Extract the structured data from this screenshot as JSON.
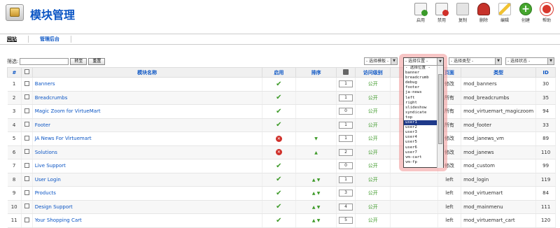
{
  "header": {
    "title": "模块管理"
  },
  "toolbar": [
    {
      "label": "启用",
      "icon": "publish-icon"
    },
    {
      "label": "禁用",
      "icon": "unpublish-icon"
    },
    {
      "label": "复制",
      "icon": "copy-icon"
    },
    {
      "label": "删除",
      "icon": "delete-icon"
    },
    {
      "label": "编辑",
      "icon": "edit-icon"
    },
    {
      "label": "创建",
      "icon": "new-icon"
    },
    {
      "label": "帮助",
      "icon": "help-icon"
    }
  ],
  "subnav": {
    "site": "网站",
    "admin": "管理后台"
  },
  "filter": {
    "label": "筛选:",
    "go": "转至",
    "reset": "重置",
    "template_select": "- 选择模板 -",
    "position_select": "- 选择位置 -",
    "type_select": "- 选择类型 -",
    "state_select": "- 选择状态 -"
  },
  "columns": [
    "#",
    "模块名称",
    "启用",
    "排序",
    "访问级别",
    "页面",
    "类型",
    "ID"
  ],
  "rows": [
    {
      "num": "1",
      "name": "Banners",
      "enabled": true,
      "order": "1",
      "access": "公开",
      "pages": "修改",
      "type": "mod_banners",
      "id": "30"
    },
    {
      "num": "2",
      "name": "Breadcrumbs",
      "enabled": true,
      "order": "1",
      "access": "公开",
      "pages": "所有",
      "type": "mod_breadcrumbs",
      "id": "35"
    },
    {
      "num": "3",
      "name": "Magic Zoom for VirtueMart",
      "enabled": true,
      "order": "0",
      "access": "公开",
      "pages": "所有",
      "type": "mod_virtuemart_magiczoom",
      "id": "94"
    },
    {
      "num": "4",
      "name": "Footer",
      "enabled": true,
      "order": "1",
      "access": "公开",
      "pages": "所有",
      "type": "mod_footer",
      "id": "33"
    },
    {
      "num": "5",
      "name": "JA News For Virtuemart",
      "enabled": false,
      "order": "1",
      "access": "公开",
      "pages": "修改",
      "type": "mod_janews_vm",
      "id": "89"
    },
    {
      "num": "6",
      "name": "Solutions",
      "enabled": false,
      "order": "2",
      "access": "公开",
      "pages": "修改",
      "type": "mod_janews",
      "id": "110"
    },
    {
      "num": "7",
      "name": "Live Support",
      "enabled": true,
      "order": "0",
      "access": "公开",
      "pages": "修改",
      "type": "mod_custom",
      "id": "99"
    },
    {
      "num": "8",
      "name": "User Login",
      "enabled": true,
      "order": "1",
      "access": "公开",
      "pages": "left",
      "type": "mod_login",
      "id": "119"
    },
    {
      "num": "9",
      "name": "Products",
      "enabled": true,
      "order": "3",
      "access": "公开",
      "pages": "left",
      "type": "mod_virtuemart",
      "id": "84"
    },
    {
      "num": "10",
      "name": "Design Support",
      "enabled": true,
      "order": "4",
      "access": "公开",
      "pages": "left",
      "type": "mod_mainmenu",
      "id": "111"
    },
    {
      "num": "11",
      "name": "Your Shopping Cart",
      "enabled": true,
      "order": "5",
      "access": "公开",
      "pages": "left",
      "type": "mod_virtuemart_cart",
      "id": "120"
    }
  ],
  "dropdown": {
    "header": "- 选择位置 -",
    "options": [
      "- 选择位置 -",
      "banner",
      "breadcrumb",
      "debug",
      "footer",
      "ja-news",
      "left",
      "right",
      "slideshow",
      "syndicate",
      "top",
      "user1",
      "user2",
      "user3",
      "user4",
      "user5",
      "user6",
      "user7",
      "vm-cart",
      "vm-fp"
    ],
    "selected": "user1"
  }
}
